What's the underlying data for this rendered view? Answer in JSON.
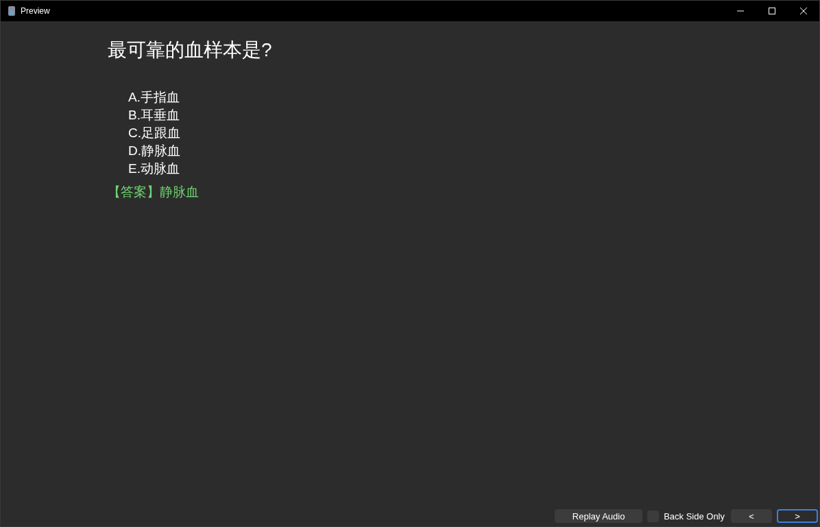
{
  "window": {
    "title": "Preview"
  },
  "card": {
    "question": "最可靠的血样本是?",
    "options": [
      "A.手指血",
      "B.耳垂血",
      "C.足跟血",
      "D.静脉血",
      "E.动脉血"
    ],
    "answer": "【答案】静脉血"
  },
  "bottom_bar": {
    "replay_button": "Replay Audio",
    "back_side_only": {
      "label": "Back Side Only",
      "checked": false
    },
    "nav_buttons": [
      {
        "label": "<",
        "focused": false
      },
      {
        "label": ">",
        "focused": true
      }
    ]
  }
}
